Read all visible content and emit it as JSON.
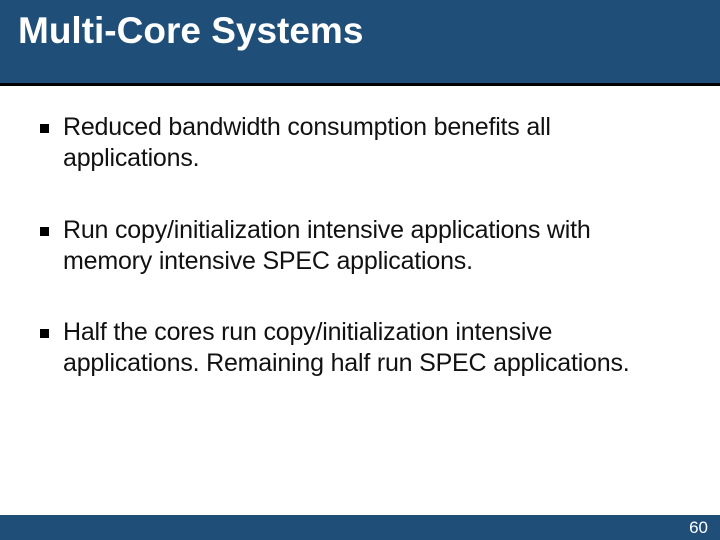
{
  "title": "Multi-Core Systems",
  "bullets": [
    "Reduced bandwidth consumption benefits all applications.",
    "Run copy/initialization intensive applications with memory intensive SPEC applications.",
    "Half the cores run copy/initialization intensive applications. Remaining half run SPEC applications."
  ],
  "page_number": "60"
}
